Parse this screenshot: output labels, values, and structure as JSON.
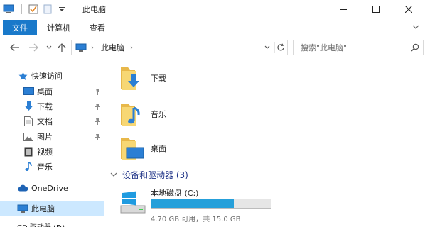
{
  "titlebar": {
    "title": "此电脑",
    "icons": [
      "computer-icon",
      "properties-checkbox-icon",
      "new-folder-icon",
      "customize-dropdown-icon"
    ],
    "controls": {
      "minimize": "—",
      "maximize": "☐",
      "close": "✕"
    }
  },
  "ribbon": {
    "tabs": [
      "文件",
      "计算机",
      "查看"
    ],
    "active_tab_color": "#1979ca"
  },
  "navigation": {
    "address_path": "此电脑",
    "search_placeholder": "搜索\"此电脑\""
  },
  "sidebar": {
    "items": [
      {
        "label": "快速访问",
        "icon": "star-icon",
        "pinned": false
      },
      {
        "label": "桌面",
        "icon": "desktop-icon",
        "pinned": true
      },
      {
        "label": "下载",
        "icon": "download-arrow-icon",
        "pinned": true
      },
      {
        "label": "文档",
        "icon": "document-icon",
        "pinned": true
      },
      {
        "label": "图片",
        "icon": "picture-icon",
        "pinned": true
      },
      {
        "label": "视频",
        "icon": "video-icon",
        "pinned": false
      },
      {
        "label": "音乐",
        "icon": "music-note-icon",
        "pinned": false
      },
      {
        "label": "OneDrive",
        "icon": "cloud-icon",
        "pinned": false
      },
      {
        "label": "此电脑",
        "icon": "computer-icon",
        "pinned": false,
        "selected": true
      }
    ],
    "partial_item": "CD 驱动器 (F:) ..."
  },
  "main": {
    "folders": [
      {
        "label": "下载",
        "icon": "download-folder-icon"
      },
      {
        "label": "音乐",
        "icon": "music-folder-icon"
      },
      {
        "label": "桌面",
        "icon": "desktop-folder-icon"
      }
    ],
    "group_header": "设备和驱动器 (3)",
    "drive": {
      "name": "本地磁盘 (C:)",
      "free_info": "4.70 GB 可用，共 15.0 GB",
      "used_fraction": 0.69,
      "bar_color": "#26a0da"
    }
  }
}
